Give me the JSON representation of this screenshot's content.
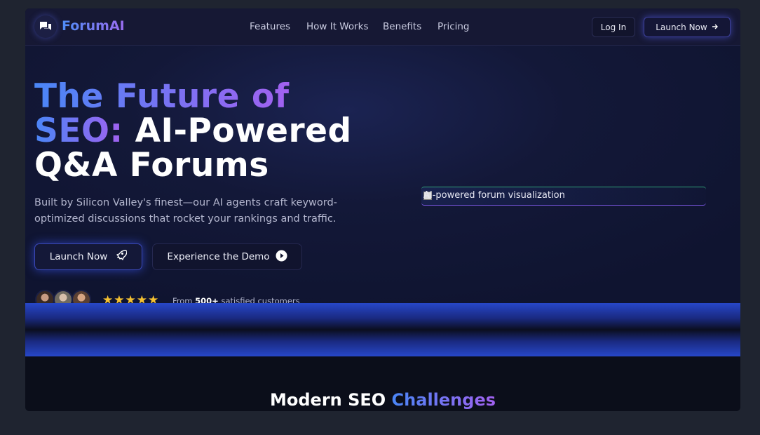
{
  "brand": {
    "name": "ForumAI"
  },
  "nav": {
    "links": [
      "Features",
      "How It Works",
      "Benefits",
      "Pricing"
    ],
    "login_label": "Log In",
    "launch_label": "Launch Now"
  },
  "hero": {
    "title_line1": "The Future of",
    "title_seo": "SEO:",
    "title_rest": " AI-Powered",
    "title_line3": "Q&A Forums",
    "subtitle": "Built by Silicon Valley's finest—our AI agents craft keyword-optimized discussions that rocket your rankings and traffic.",
    "primary_cta": "Launch Now",
    "secondary_cta": "Experience the Demo",
    "rating_stars": 5,
    "stars": "★★★★★",
    "customers_prefix": "From ",
    "customers_count": "500+",
    "customers_suffix": " satisfied customers",
    "image_alt": "AI-powered forum visualization"
  },
  "section": {
    "title_plain": "Modern SEO ",
    "title_highlight": "Challenges"
  },
  "colors": {
    "accent_blue": "#4a86f6",
    "accent_purple": "#a261f0",
    "star": "#f6c231",
    "background": "#0b0e1a"
  }
}
